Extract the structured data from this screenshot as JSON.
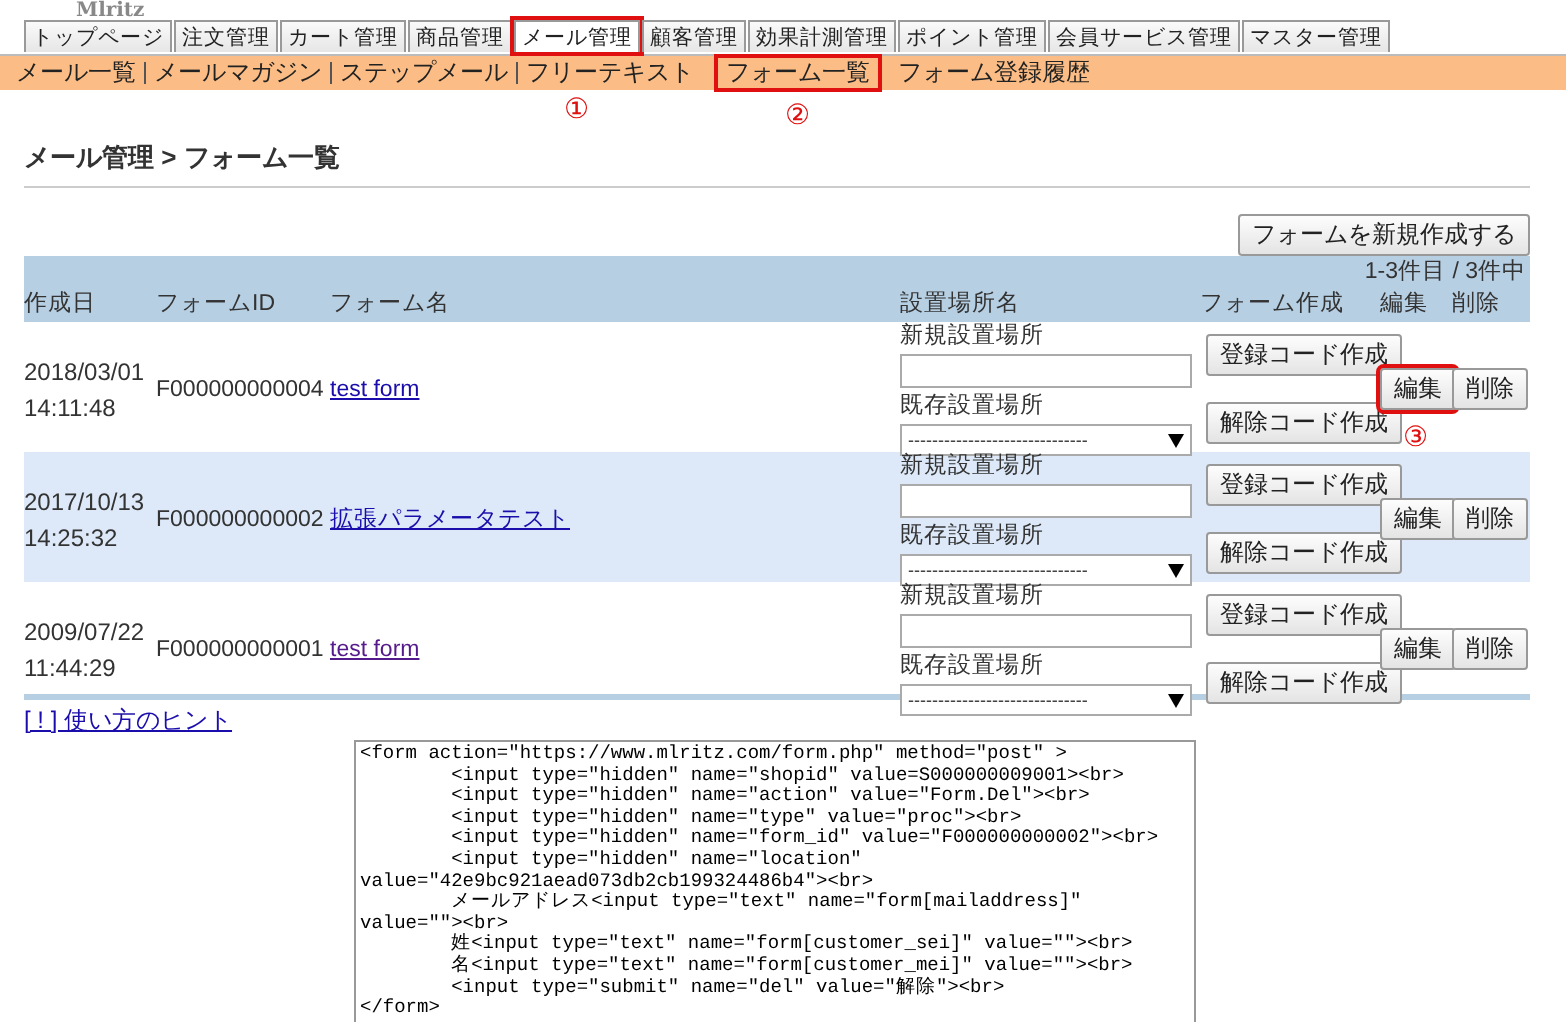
{
  "logo": "Mlritz",
  "tabs": [
    {
      "label": "トップページ",
      "selected": false,
      "highlighted": false
    },
    {
      "label": "注文管理",
      "selected": false,
      "highlighted": false
    },
    {
      "label": "カート管理",
      "selected": false,
      "highlighted": false
    },
    {
      "label": "商品管理",
      "selected": false,
      "highlighted": false
    },
    {
      "label": "メール管理",
      "selected": true,
      "highlighted": true,
      "annotation": "①"
    },
    {
      "label": "顧客管理",
      "selected": false,
      "highlighted": false
    },
    {
      "label": "効果計測管理",
      "selected": false,
      "highlighted": false
    },
    {
      "label": "ポイント管理",
      "selected": false,
      "highlighted": false
    },
    {
      "label": "会員サービス管理",
      "selected": false,
      "highlighted": false
    },
    {
      "label": "マスター管理",
      "selected": false,
      "highlighted": false
    }
  ],
  "subnav": [
    {
      "label": "メール一覧",
      "highlighted": false
    },
    {
      "label": "メールマガジン",
      "highlighted": false
    },
    {
      "label": "ステップメール",
      "highlighted": false
    },
    {
      "label": "フリーテキスト",
      "highlighted": false
    },
    {
      "label": "フォーム一覧",
      "highlighted": true,
      "annotation": "②"
    },
    {
      "label": "フォーム登録履歴",
      "highlighted": false
    }
  ],
  "page_title": "メール管理 > フォーム一覧",
  "new_button": "フォームを新規作成する",
  "table": {
    "count": "1-3件目 / 3件中",
    "columns": [
      "作成日",
      "フォームID",
      "フォーム名",
      "設置場所名",
      "フォーム作成",
      "編集",
      "削除"
    ],
    "rows": [
      {
        "date": "2018/03/01",
        "time": "14:11:48",
        "id": "F000000000004",
        "name": "test form",
        "visited": false,
        "new_label": "新規設置場所",
        "new_value": "",
        "existing_label": "既存設置場所",
        "existing_value": "------------------------------",
        "register_button": "登録コード作成",
        "cancel_button": "解除コード作成",
        "edit_button": "編集",
        "edit_highlighted": true,
        "edit_annotation": "③",
        "delete_button": "削除"
      },
      {
        "date": "2017/10/13",
        "time": "14:25:32",
        "id": "F000000000002",
        "name": "拡張パラメータテスト",
        "visited": false,
        "new_label": "新規設置場所",
        "new_value": "",
        "existing_label": "既存設置場所",
        "existing_value": "------------------------------",
        "register_button": "登録コード作成",
        "cancel_button": "解除コード作成",
        "edit_button": "編集",
        "edit_highlighted": false,
        "delete_button": "削除"
      },
      {
        "date": "2009/07/22",
        "time": "11:44:29",
        "id": "F000000000001",
        "name": "test form",
        "visited": true,
        "new_label": "新規設置場所",
        "new_value": "",
        "existing_label": "既存設置場所",
        "existing_value": "------------------------------",
        "register_button": "登録コード作成",
        "cancel_button": "解除コード作成",
        "edit_button": "編集",
        "edit_highlighted": false,
        "delete_button": "削除"
      }
    ]
  },
  "hint_link": "[ ! ] 使い方のヒント",
  "code": "<form action=\"https://www.mlritz.com/form.php\" method=\"post\" >\n\t<input type=\"hidden\" name=\"shopid\" value=S000000009001><br>\n\t<input type=\"hidden\" name=\"action\" value=\"Form.Del\"><br>\n\t<input type=\"hidden\" name=\"type\" value=\"proc\"><br>\n\t<input type=\"hidden\" name=\"form_id\" value=\"F000000000002\"><br>\n\t<input type=\"hidden\" name=\"location\" value=\"42e9bc921aead073db2cb199324486b4\"><br>\n\tメールアドレス<input type=\"text\" name=\"form[mailaddress]\" value=\"\"><br>\n\t姓<input type=\"text\" name=\"form[customer_sei]\" value=\"\"><br>\n\t名<input type=\"text\" name=\"form[customer_mei]\" value=\"\"><br>\n\t<input type=\"submit\" name=\"del\" value=\"解除\"><br>\n</form>"
}
